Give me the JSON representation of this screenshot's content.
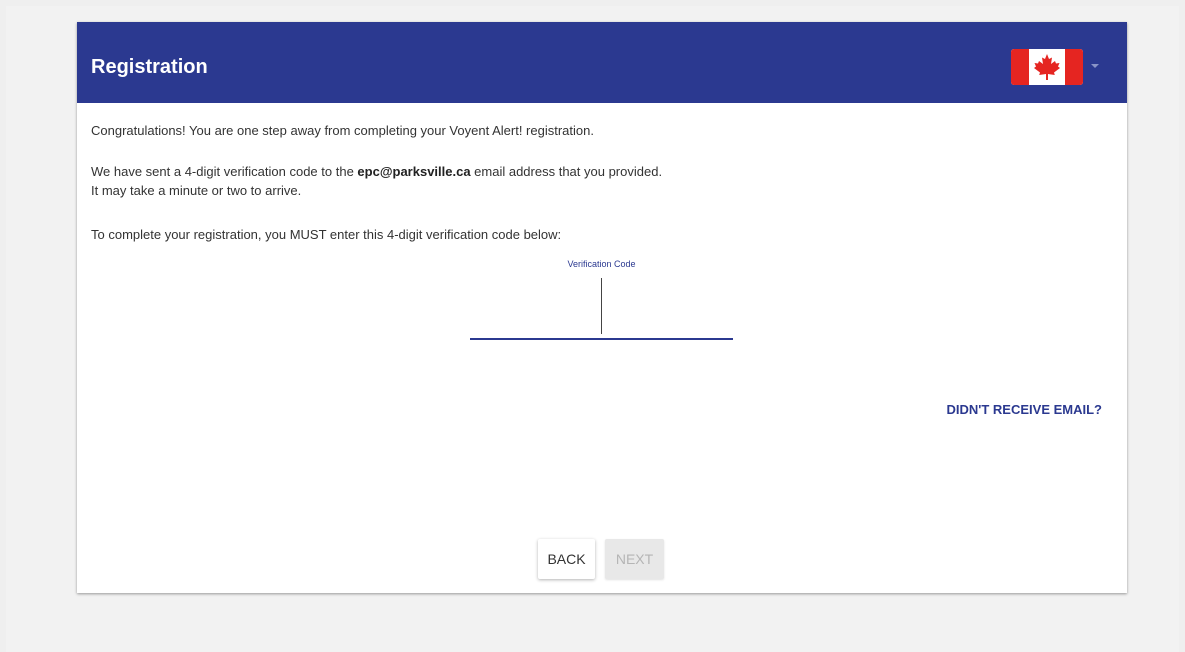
{
  "header": {
    "title": "Registration",
    "language_flag": "canada-flag-icon"
  },
  "content": {
    "line1": "Congratulations! You are one step away from completing your Voyent Alert! registration.",
    "line2_prefix": "We have sent a 4-digit verification code to the ",
    "line2_email": "epc@parksville.ca",
    "line2_suffix": " email address that you provided.",
    "line3": "It may take a minute or two to arrive.",
    "line4": "To complete your registration, you MUST enter this 4-digit verification code below:"
  },
  "verification": {
    "label": "Verification Code",
    "value": ""
  },
  "resend_link": "DIDN'T RECEIVE EMAIL?",
  "buttons": {
    "back": "BACK",
    "next": "NEXT"
  },
  "colors": {
    "brand": "#2b3990",
    "flag_red": "#e52521",
    "disabled_bg": "#e8e8e8"
  }
}
